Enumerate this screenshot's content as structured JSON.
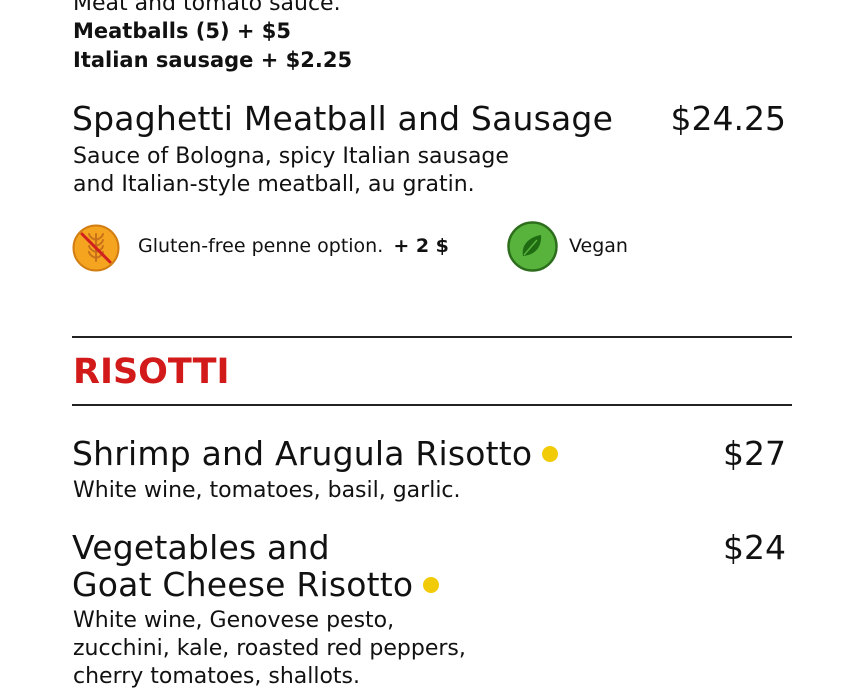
{
  "colors": {
    "accent_red": "#d21a1a",
    "dot_yellow": "#f2cb07",
    "gluten_orange": "#f4a41f",
    "vegan_green": "#58b33c"
  },
  "previous_item": {
    "desc_line": "Meat and tomato sauce.",
    "addons": [
      "Meatballs (5) + $5",
      "Italian sausage + $2.25"
    ]
  },
  "spaghetti": {
    "name": "Spaghetti Meatball and Sausage",
    "price": "$24.25",
    "desc": [
      "Sauce of Bologna, spicy Italian sausage",
      "and Italian-style meatball, au gratin."
    ],
    "gluten_free_label": "Gluten-free penne option.",
    "gluten_free_price": "+ 2 $",
    "vegan_label": "Vegan",
    "icons": {
      "gluten_free": "gluten-free-wheat-icon",
      "vegan": "leaf-icon"
    }
  },
  "section": {
    "title": "RISOTTI"
  },
  "risotti": [
    {
      "name": "Shrimp and Arugula Risotto",
      "price": "$27",
      "desc": [
        "White wine, tomatoes, basil, garlic."
      ]
    },
    {
      "name_lines": [
        "Vegetables and",
        "Goat Cheese Risotto"
      ],
      "price": "$24",
      "desc": [
        "White wine, Genovese pesto,",
        "zucchini, kale, roasted red peppers,",
        "cherry tomatoes, shallots."
      ]
    }
  ]
}
